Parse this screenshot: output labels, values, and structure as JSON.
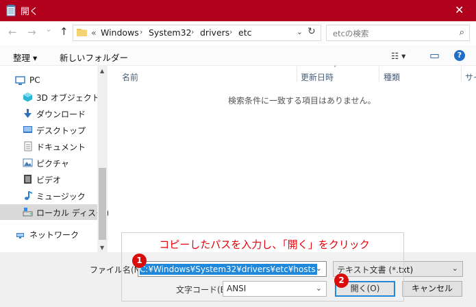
{
  "window": {
    "title": "開く",
    "close_glyph": "✕"
  },
  "nav": {
    "back_glyph": "←",
    "forward_glyph": "→",
    "recent_glyph": "⌄",
    "up_glyph": "↑",
    "address": {
      "prefix": "«",
      "crumbs": [
        "Windows",
        "System32",
        "drivers",
        "etc"
      ],
      "separator": "›",
      "dropdown_glyph": "⌄"
    },
    "refresh_glyph": "↻",
    "search": {
      "placeholder": "etcの検索",
      "icon_glyph": "⌕"
    }
  },
  "toolbar": {
    "organize_label": "整理 ▾",
    "new_folder_label": "新しいフォルダー",
    "view_glyph": "☷ ▾",
    "pane_glyph": "▭",
    "help_glyph": "?"
  },
  "sidebar": {
    "items": [
      {
        "label": "PC",
        "icon": "pc-icon",
        "color": "#3b7fc4"
      },
      {
        "label": "3D オブジェクト",
        "icon": "3d-objects-icon",
        "color": "#2ab6d4"
      },
      {
        "label": "ダウンロード",
        "icon": "download-icon",
        "color": "#2c6fbe"
      },
      {
        "label": "デスクトップ",
        "icon": "desktop-icon",
        "color": "#2f75c9"
      },
      {
        "label": "ドキュメント",
        "icon": "documents-icon",
        "color": "#8a8a8a"
      },
      {
        "label": "ピクチャ",
        "icon": "pictures-icon",
        "color": "#4a7fb5"
      },
      {
        "label": "ビデオ",
        "icon": "videos-icon",
        "color": "#444444"
      },
      {
        "label": "ミュージック",
        "icon": "music-icon",
        "color": "#2a7fd0"
      },
      {
        "label": "ローカル ディスク (C",
        "icon": "local-disk-icon",
        "color": "#6b6b6b",
        "selected": true
      },
      {
        "label": "ネットワーク",
        "icon": "network-icon",
        "color": "#3a7ec0"
      }
    ]
  },
  "columns": {
    "name": "名前",
    "modified": "更新日時",
    "type": "種類",
    "size": "サイ"
  },
  "empty_message": "検索条件に一致する項目はありません。",
  "bottom": {
    "filename_label": "ファイル名(N):",
    "filename_value": "C:¥Windows¥System32¥drivers¥etc¥hosts",
    "filetype_value": "テキスト文書 (*.txt)",
    "encoding_label": "文字コード(E):",
    "encoding_value": "ANSI",
    "open_button": "開く(O)",
    "cancel_button": "キャンセル"
  },
  "annotation": {
    "text": "コピーしたパスを入力し、「開く」をクリック",
    "badge1": "1",
    "badge2": "2",
    "color": "#e8000b"
  },
  "colors": {
    "titlebar": "#b1001c",
    "selection": "#0078d7"
  }
}
